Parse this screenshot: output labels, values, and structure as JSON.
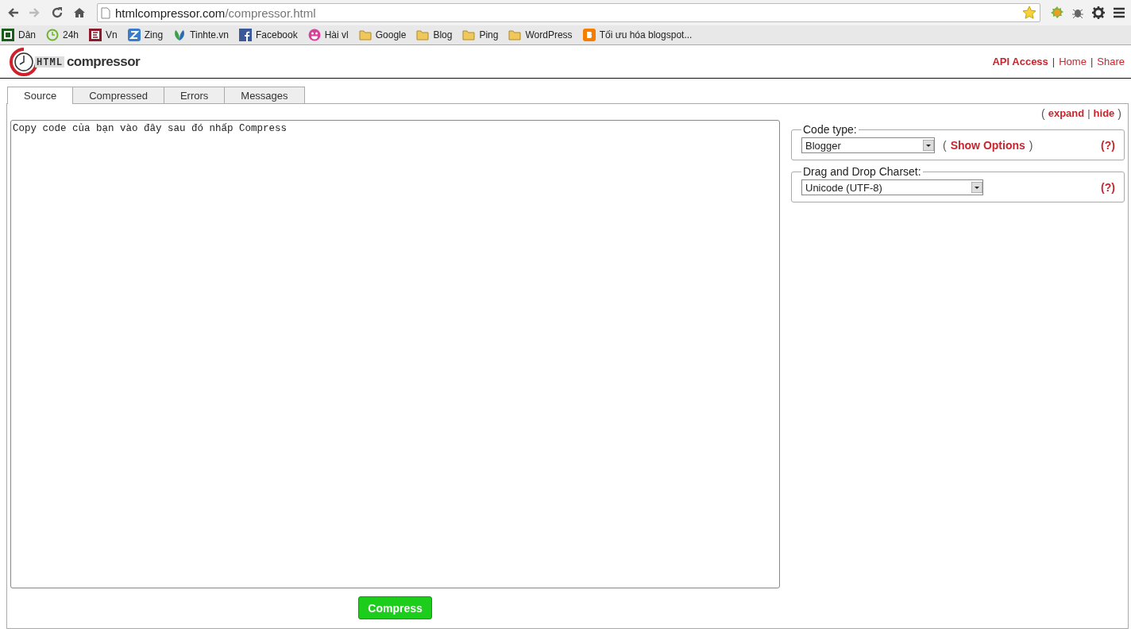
{
  "browser": {
    "address": {
      "host": "htmlcompressor.com",
      "path": "/compressor.html"
    },
    "bookmarks": [
      {
        "label": "Dân",
        "kind": "d"
      },
      {
        "label": "24h",
        "kind": "clock"
      },
      {
        "label": "Vn",
        "kind": "e"
      },
      {
        "label": "Zing",
        "kind": "z"
      },
      {
        "label": "Tinhte.vn",
        "kind": "leaf"
      },
      {
        "label": "Facebook",
        "kind": "facebook"
      },
      {
        "label": "Hài vl",
        "kind": "smile"
      },
      {
        "label": "Google",
        "kind": "folder"
      },
      {
        "label": "Blog",
        "kind": "folder"
      },
      {
        "label": "Ping",
        "kind": "folder"
      },
      {
        "label": "WordPress",
        "kind": "folder"
      },
      {
        "label": "Tối ưu hóa blogspot...",
        "kind": "blogger"
      }
    ]
  },
  "header": {
    "logo_mark": "HTML",
    "logo_text": "compressor",
    "links": [
      {
        "label": "API Access",
        "bold": true
      },
      {
        "label": "Home",
        "bold": false
      },
      {
        "label": "Share",
        "bold": false
      }
    ],
    "separator": "|"
  },
  "tabs": [
    {
      "label": "Source",
      "selected": true
    },
    {
      "label": "Compressed",
      "selected": false
    },
    {
      "label": "Errors",
      "selected": false
    },
    {
      "label": "Messages",
      "selected": false
    }
  ],
  "source": {
    "value": "Copy code của bạn vào đây sau đó nhấp Compress"
  },
  "panel_toggle": {
    "open": "(",
    "expand": "expand",
    "separator": "|",
    "hide": "hide",
    "close": ")"
  },
  "options": [
    {
      "legend": "Code type:",
      "value": "Blogger",
      "link": {
        "open": "(",
        "label": "Show Options",
        "close": ")"
      },
      "help": "(?)"
    },
    {
      "legend": "Drag and Drop Charset:",
      "value": "Unicode (UTF-8)",
      "help": "(?)"
    }
  ],
  "compress_button": "Compress"
}
